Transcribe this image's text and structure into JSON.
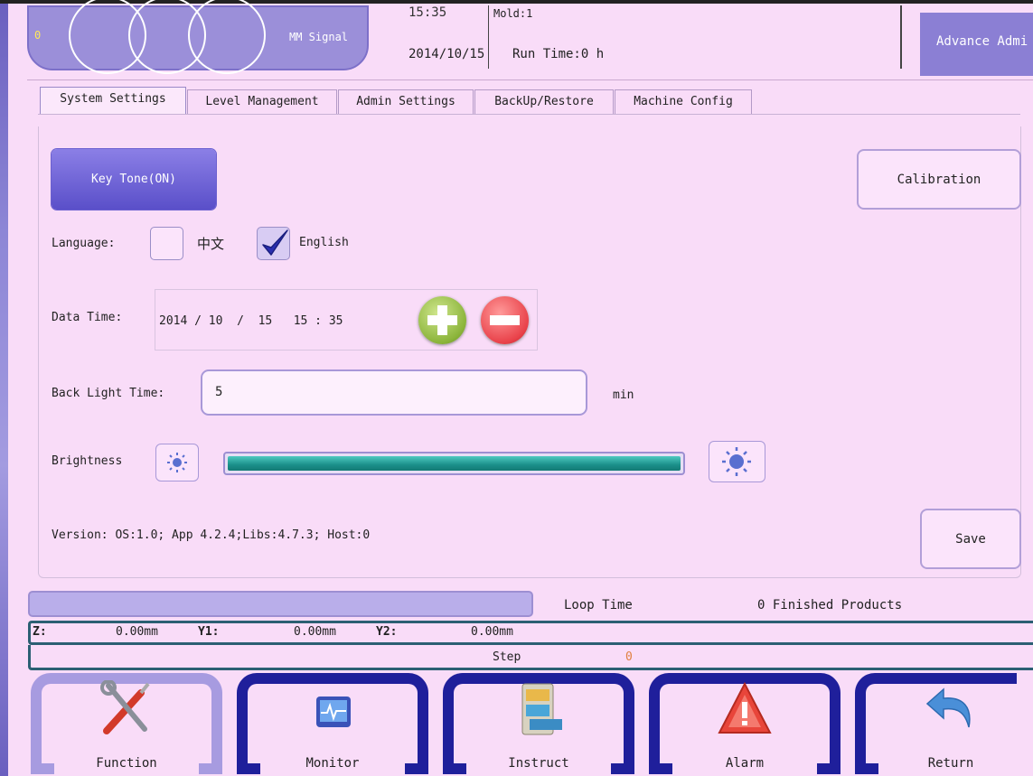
{
  "header": {
    "counter": "0",
    "signal_label": "MM Signal",
    "time": "15:35",
    "date": "2014/10/15",
    "mold": "Mold:1",
    "run_time": "Run Time:0 h",
    "user_level": "Advance Admi"
  },
  "tabs": [
    {
      "label": "System Settings",
      "active": true
    },
    {
      "label": "Level Management",
      "active": false
    },
    {
      "label": "Admin Settings",
      "active": false
    },
    {
      "label": "BackUp/Restore",
      "active": false
    },
    {
      "label": "Machine Config",
      "active": false
    }
  ],
  "settings": {
    "key_tone_label": "Key Tone(ON)",
    "calibration_label": "Calibration",
    "language_label": "Language:",
    "language_options": [
      {
        "label": "中文",
        "checked": false
      },
      {
        "label": "English",
        "checked": true
      }
    ],
    "datetime_label": "Data Time:",
    "datetime_value": "2014 / 10  /  15   15 : 35",
    "backlight_label": "Back Light Time:",
    "backlight_value": "5",
    "backlight_unit": "min",
    "brightness_label": "Brightness",
    "brightness_level": 1.0,
    "version": "Version: OS:1.0; App 4.2.4;Libs:4.7.3; Host:0",
    "save_label": "Save"
  },
  "status": {
    "loop_time_label": "Loop Time",
    "finished_products": "0 Finished Products",
    "z_label": "Z:",
    "z_value": "0.00mm",
    "y1_label": "Y1:",
    "y1_value": "0.00mm",
    "y2_label": "Y2:",
    "y2_value": "0.00mm",
    "step_label": "Step",
    "step_value": "0"
  },
  "nav": [
    {
      "label": "Function",
      "icon": "tools-icon",
      "active": true
    },
    {
      "label": "Monitor",
      "icon": "monitor-icon",
      "active": false
    },
    {
      "label": "Instruct",
      "icon": "cabinet-icon",
      "active": false
    },
    {
      "label": "Alarm",
      "icon": "warning-icon",
      "active": false
    },
    {
      "label": "Return",
      "icon": "return-arrow-icon",
      "active": false
    }
  ],
  "colors": {
    "background": "#f9dcf8",
    "accent": "#5a4fc9",
    "nav_frame": "#1f1f9b",
    "brightness_fill": "#1b8f8a"
  }
}
